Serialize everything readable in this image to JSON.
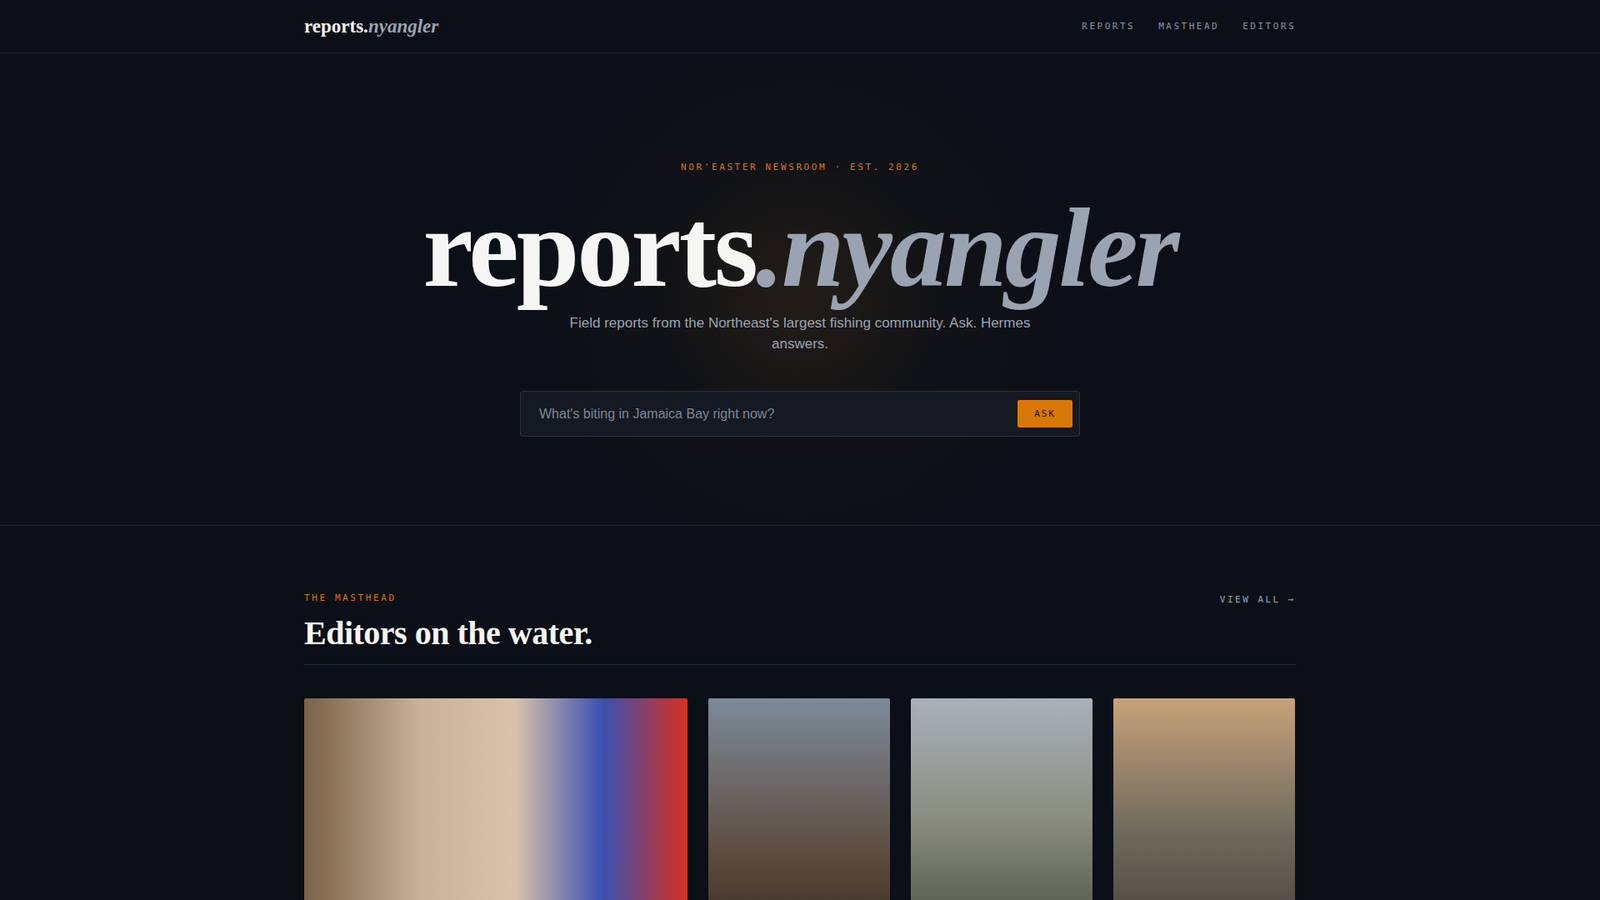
{
  "nav": {
    "logo": {
      "main": "reports.",
      "alt": "nyangler"
    },
    "links": [
      "REPORTS",
      "MASTHEAD",
      "EDITORS"
    ]
  },
  "hero": {
    "eyebrow": "NOR'EASTER NEWSROOM · EST. 2026",
    "title": {
      "main": "reports",
      "alt": ".nyangler"
    },
    "subtitle": "Field reports from the Northeast's largest fishing community. Ask. Hermes answers."
  },
  "search": {
    "placeholder": "What's biting in Jamaica Bay right now?",
    "button": "ASK"
  },
  "masthead": {
    "eyebrow": "THE MASTHEAD",
    "heading": "Editors on the water.",
    "view_all": "VIEW ALL →",
    "editors": [
      {
        "kind": "featured"
      },
      {
        "kind": "standard"
      },
      {
        "kind": "standard"
      },
      {
        "kind": "standard"
      }
    ]
  }
}
